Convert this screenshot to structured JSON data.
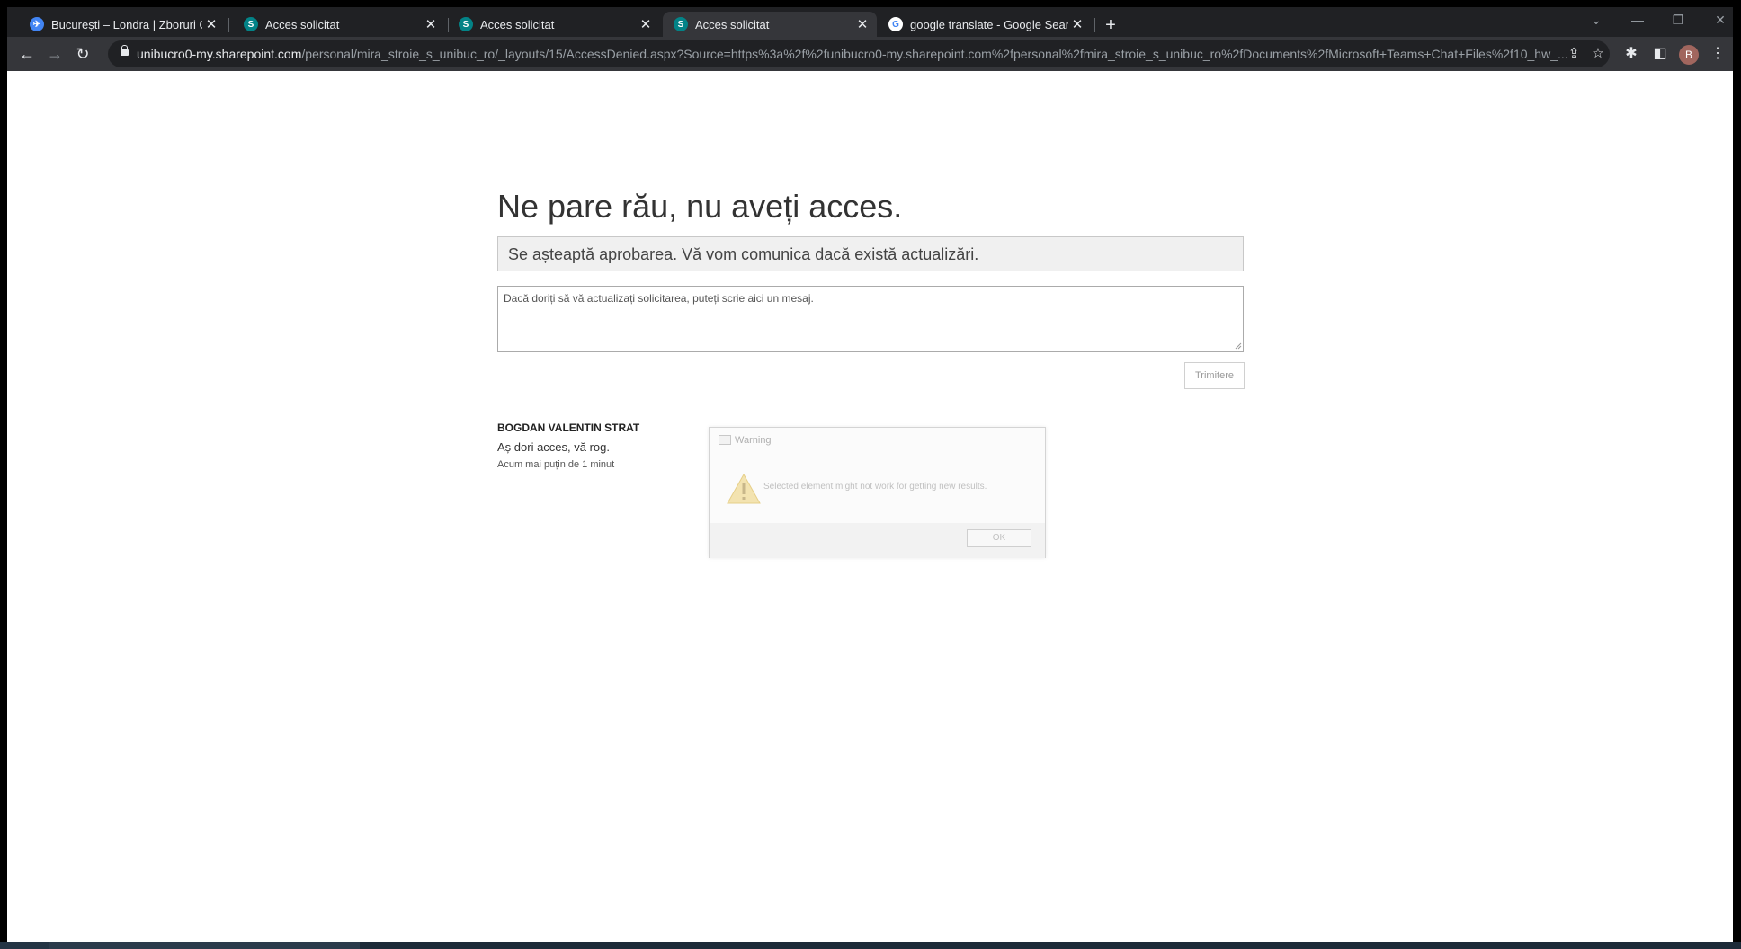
{
  "browser": {
    "tabs": [
      {
        "title": "București – Londra | Zboruri Goo",
        "favicon": "google-flights-icon",
        "favicon_color": "#4285f4",
        "active": false
      },
      {
        "title": "Acces solicitat",
        "favicon": "sharepoint-icon",
        "favicon_color": "#038387",
        "active": false
      },
      {
        "title": "Acces solicitat",
        "favicon": "sharepoint-icon",
        "favicon_color": "#038387",
        "active": false
      },
      {
        "title": "Acces solicitat",
        "favicon": "sharepoint-icon",
        "favicon_color": "#038387",
        "active": true
      },
      {
        "title": "google translate - Google Search",
        "favicon": "google-icon",
        "favicon_color": "#ffffff",
        "active": false
      }
    ],
    "url_host": "unibucro0-my.sharepoint.com",
    "url_path": "/personal/mira_stroie_s_unibuc_ro/_layouts/15/AccessDenied.aspx?Source=https%3a%2f%2funibucro0-my.sharepoint.com%2fpersonal%2fmira_stroie_s_unibuc_ro%2fDocuments%2fMicrosoft+Teams+Chat+Files%2f10_hw_...",
    "profile_initial": "B"
  },
  "page": {
    "heading": "Ne pare rău, nu aveți acces.",
    "status": "Se așteaptă aprobarea. Vă vom comunica dacă există actualizări.",
    "message_placeholder": "Dacă doriți să vă actualizați solicitarea, puteți scrie aici un mesaj.",
    "send_label": "Trimitere",
    "request": {
      "name": "BOGDAN VALENTIN STRAT",
      "message": "Aș dori acces, vă rog.",
      "time": "Acum mai puțin de 1 minut"
    }
  },
  "dialog": {
    "title": "Warning",
    "text": "Selected element might not work for getting new results.",
    "ok_label": "OK"
  }
}
